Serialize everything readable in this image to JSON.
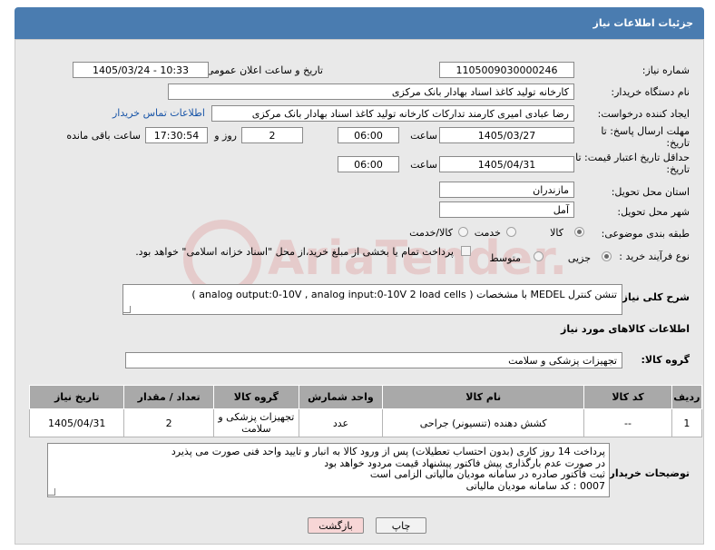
{
  "header": {
    "title": "جزئیات اطلاعات نیاز"
  },
  "fields": {
    "need_number_label": "شماره نیاز:",
    "need_number": "1105009030000246",
    "announce_label": "تاریخ و ساعت اعلان عمومی:",
    "announce_value": "1405/03/24 - 10:33",
    "buyer_org_label": "نام دستگاه خریدار:",
    "buyer_org": "کارخانه تولید کاغذ اسناد بهادار بانک مرکزی",
    "creator_label": "ایجاد کننده درخواست:",
    "creator": "رضا عبادی امیری کارمند تدارکات کارخانه تولید کاغذ اسناد بهادار بانک مرکزی",
    "contact_link": "اطلاعات تماس خریدار",
    "deadline_label": "مهلت ارسال پاسخ: تا تاریخ:",
    "deadline_date": "1405/03/27",
    "time_label": "ساعت",
    "deadline_time": "06:00",
    "days_value": "2",
    "days_label": "روز و",
    "remaining_time": "17:30:54",
    "remaining_label": "ساعت باقی مانده",
    "validity_label": "حداقل تاریخ اعتبار قیمت: تا تاریخ:",
    "validity_date": "1405/04/31",
    "validity_time": "06:00",
    "province_label": "استان محل تحویل:",
    "province": "مازندران",
    "city_label": "شهر محل تحویل:",
    "city": "آمل",
    "category_label": "طبقه بندی موضوعی:",
    "category_options": [
      "کالا",
      "خدمت",
      "کالا/خدمت"
    ],
    "process_label": "نوع فرآیند خرید :",
    "process_options": [
      "جزیی",
      "متوسط"
    ],
    "payment_note": "پرداخت تمام یا بخشی از مبلغ خرید،از محل \"اسناد خزانه اسلامی\" خواهد بود."
  },
  "description": {
    "label": "شرح کلی نیاز:",
    "text": "تنشن کنترل  MEDEL  با مشخصات  (  analog output:0-10V , analog input:0-10V 2 load cells  )"
  },
  "goods_section": {
    "title": "اطلاعات کالاهای مورد نیاز",
    "group_label": "گروه کالا:",
    "group_value": "تجهیزات پزشکی و سلامت"
  },
  "table": {
    "headers": [
      "ردیف",
      "کد کالا",
      "نام کالا",
      "واحد شمارش",
      "گروه کالا",
      "تعداد / مقدار",
      "تاریخ نیاز"
    ],
    "rows": [
      [
        "1",
        "--",
        "کشش دهنده (تنسیونر) جراحی",
        "عدد",
        "تجهیزات پزشکی و سلامت",
        "2",
        "1405/04/31"
      ]
    ]
  },
  "buyer_notes": {
    "label": "توضیحات خریدار:",
    "lines": [
      "پرداخت 14 روز کاری (بدون احتساب تعطیلات) پس از ورود کالا به انبار و تایید واحد فنی صورت می پذیرد",
      "در صورت عدم بارگذاری پیش فاکتور پیشنهاد قیمت مردود خواهد بود",
      "ثبت فاکتور صادره در سامانه مودیان مالیاتی الزامی است",
      "0007 : کد سامانه مودیان مالیاتی"
    ]
  },
  "buttons": {
    "print": "چاپ",
    "back": "بازگشت"
  },
  "watermark": "AriaTender.net"
}
